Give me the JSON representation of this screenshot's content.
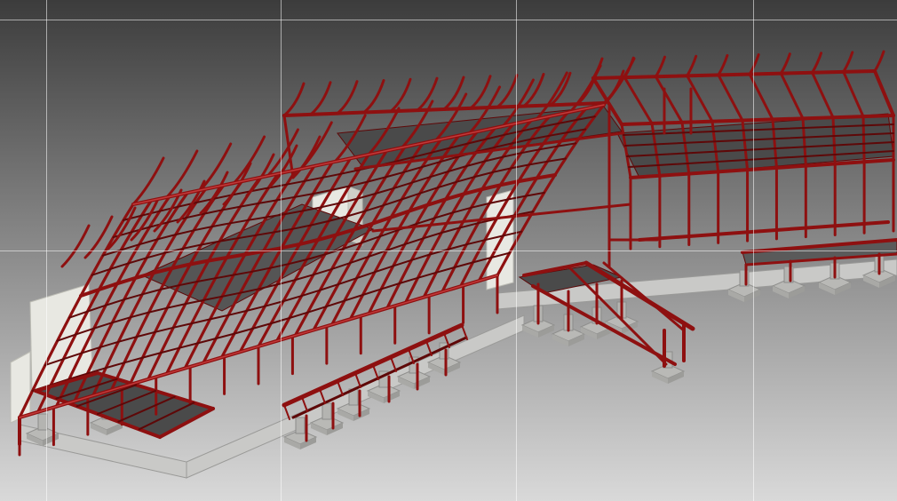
{
  "viewport": {
    "background_top": "#3c3c3c",
    "background_bottom": "#d9d9d9"
  },
  "colors": {
    "steel_frame": "#8e1010",
    "steel_frame_dark": "#5e0808",
    "steel_highlight": "#c23a3a",
    "concrete": "#c9c9c7",
    "concrete_shadow": "#9a9a98",
    "core_wall": "#e8e8e2",
    "deck_grating": "#4a4a4a",
    "grid_line": "#ffffff"
  },
  "model": {
    "element_types": [
      "steel-frame",
      "roof-purlins",
      "floor-deck-grating",
      "concrete-footings",
      "core-walls",
      "grid-lines"
    ]
  }
}
